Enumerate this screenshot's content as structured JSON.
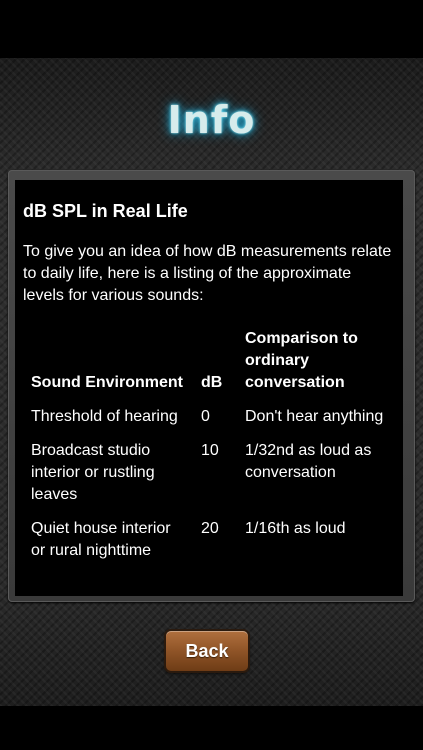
{
  "screen": {
    "title": "Info"
  },
  "content": {
    "heading": "dB SPL in Real Life",
    "intro": "To give you an idea of how dB measurements relate to daily life, here is a listing of the approximate levels for various sounds:",
    "table": {
      "headers": {
        "environment": "Sound Environment",
        "db": "dB",
        "comparison": "Comparison to ordinary conversation"
      },
      "rows": [
        {
          "environment": "Threshold of hearing",
          "db": "0",
          "comparison": "Don't hear anything"
        },
        {
          "environment": "Broadcast studio interior or rustling leaves",
          "db": "10",
          "comparison": "1/32nd as loud as conversation"
        },
        {
          "environment": "Quiet house interior or rural nighttime",
          "db": "20",
          "comparison": "1/16th as loud"
        }
      ]
    }
  },
  "footer": {
    "back_label": "Back"
  },
  "colors": {
    "title_glow": "#39c6e6",
    "button_brown": "#8f5427",
    "panel_bg": "#000000"
  }
}
